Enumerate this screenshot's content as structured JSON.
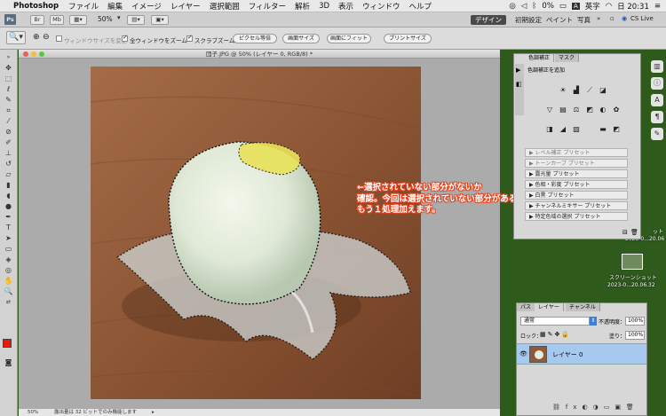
{
  "menubar": {
    "app": "Photoshop",
    "items": [
      "ファイル",
      "編集",
      "イメージ",
      "レイヤー",
      "選択範囲",
      "フィルター",
      "解析",
      "3D",
      "表示",
      "ウィンドウ",
      "ヘルプ"
    ],
    "battery": "0%",
    "ime": "英字",
    "clock": "日 20:31"
  },
  "appbar": {
    "logo": "Ps",
    "zoom": "50%",
    "workspaces": [
      "デザイン",
      "初期設定",
      "ペイント",
      "写真"
    ],
    "cslive": "CS Live"
  },
  "options": {
    "resize_windows": "ウィンドウサイズを変更",
    "zoom_all": "全ウィンドウをズーム",
    "scrubby_zoom": "スクラブズーム",
    "actual_pixels": "ピクセル等倍",
    "fit_screen": "画面サイズ",
    "fill_screen": "画面にフィット",
    "print_size": "プリントサイズ"
  },
  "document": {
    "title": "団子.JPG @ 50% (レイヤー 0, RGB/8) *",
    "status_zoom": "50%",
    "status_text": "露出量は 32 ビットでのみ機能します"
  },
  "annotation": {
    "lines": [
      "←選択されていない部分がないか",
      "確認。今回は選択されていない部分があるので",
      "もう１処理加えます。"
    ]
  },
  "adjustments": {
    "tab_active": "色調補正",
    "tab_other": "マスク",
    "add_label": "色調補正を追加",
    "presets": [
      "レベル補正 プリセット",
      "トーンカーブ プリセット",
      "露光量 プリセット",
      "色相・彩度 プリセット",
      "白黒 プリセット",
      "チャンネルミキサー プリセット",
      "特定色域の選択 プリセット"
    ]
  },
  "layers": {
    "tabs": [
      "パス",
      "レイヤー",
      "チャンネル"
    ],
    "blend_mode": "通常",
    "opacity_label": "不透明度：",
    "opacity": "100%",
    "lock_label": "ロック：",
    "fill_label": "塗り：",
    "fill": "100%",
    "layer_name": "レイヤー 0"
  },
  "desktop": {
    "screenshot_label": "スクリーンショット",
    "screenshot_date": "2023-0...20.06.32",
    "partial_label_top": "ット",
    "partial_date_top": "2023-0...20.06"
  }
}
